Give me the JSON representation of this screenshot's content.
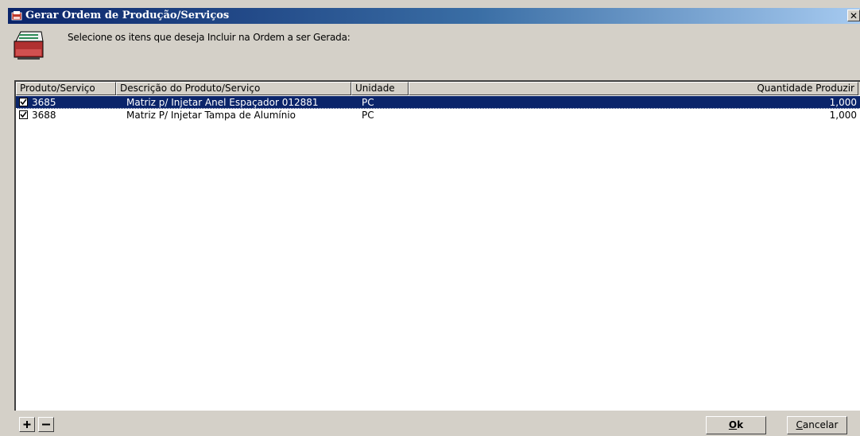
{
  "window": {
    "title": "Gerar Ordem de Produção/Serviços",
    "close_glyph": "✕"
  },
  "header": {
    "instruction": "Selecione os itens que deseja Incluir na Ordem a ser Gerada:",
    "icon": "printer-document-icon"
  },
  "grid": {
    "columns": [
      {
        "label": "Produto/Serviço"
      },
      {
        "label": "Descrição do Produto/Serviço"
      },
      {
        "label": "Unidade"
      },
      {
        "label": "Quantidade Produzir"
      }
    ],
    "rows": [
      {
        "checked": true,
        "code": "3685",
        "description": "Matriz p/ Injetar Anel Espaçador 012881",
        "unit": "PC",
        "quantity": "1,000",
        "selected": true
      },
      {
        "checked": true,
        "code": "3688",
        "description": "Matriz P/ Injetar Tampa de Alumínio",
        "unit": "PC",
        "quantity": "1,000",
        "selected": false
      }
    ]
  },
  "footer": {
    "add_icon": "plus-icon",
    "remove_icon": "minus-icon",
    "ok_label_first": "O",
    "ok_label_rest": "k",
    "cancel_label_first": "C",
    "cancel_label_rest": "ancelar"
  },
  "colors": {
    "selection": "#0a246a",
    "title_gradient_start": "#0a246a",
    "title_gradient_end": "#a6caf0",
    "window_bg": "#d4d0c8"
  }
}
